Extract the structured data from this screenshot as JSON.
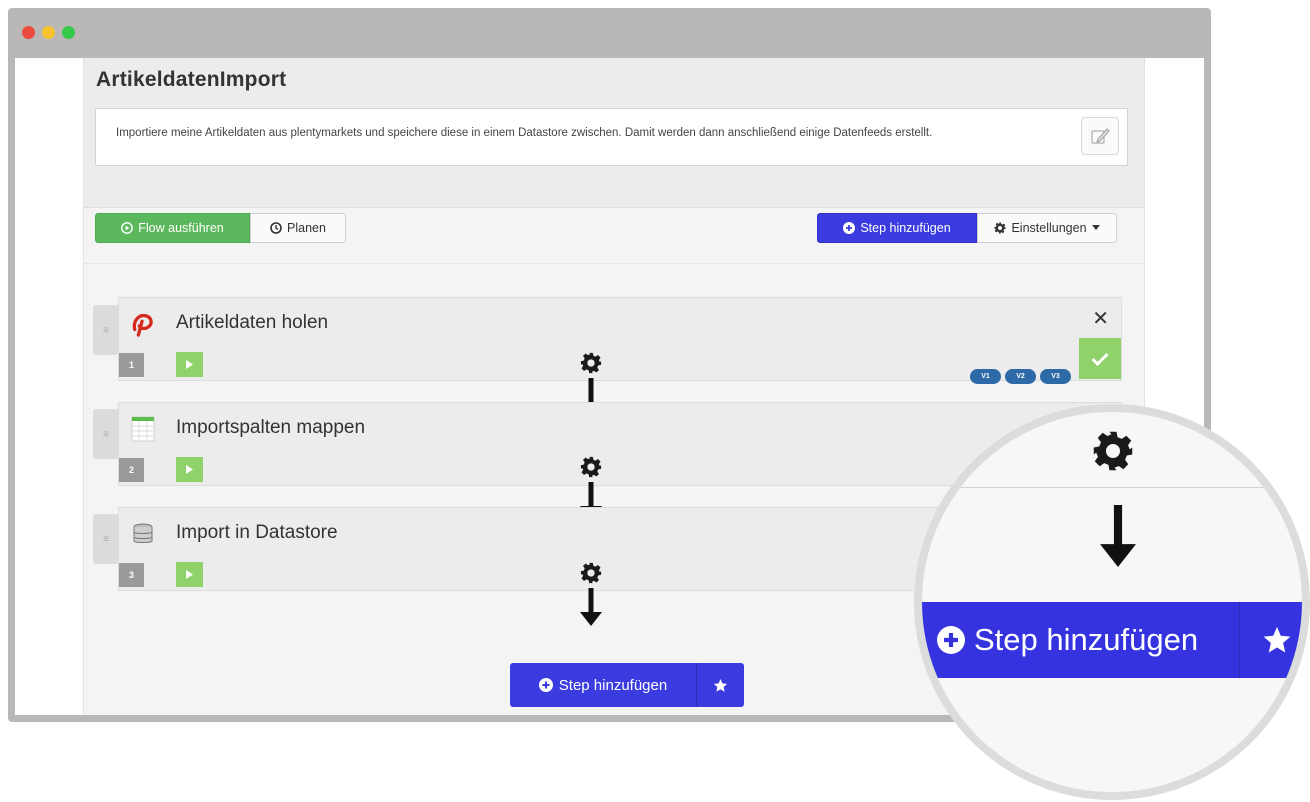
{
  "window": {
    "controls": [
      "close",
      "minimize",
      "maximize"
    ]
  },
  "flow": {
    "title": "ArtikeldatenImport",
    "description": "Importiere meine Artikeldaten aus plentymarkets und speichere diese in einem Datastore zwischen. Damit werden dann anschließend einige Datenfeeds erstellt."
  },
  "toolbar": {
    "run_label": "Flow ausführen",
    "plan_label": "Planen",
    "add_step_label": "Step hinzufügen",
    "settings_label": "Einstellungen"
  },
  "steps": [
    {
      "number": "1",
      "title": "Artikeldaten holen",
      "icon": "plentymarkets-logo-icon",
      "versions": [
        "V1",
        "V2",
        "V3"
      ]
    },
    {
      "number": "2",
      "title": "Importspalten mappen",
      "icon": "table-icon"
    },
    {
      "number": "3",
      "title": "Import in Datastore",
      "icon": "database-icon"
    }
  ],
  "bottom": {
    "add_step_label": "Step hinzufügen"
  },
  "zoom": {
    "add_step_label": "Step hinzufügen"
  },
  "colors": {
    "primary_blue": "#3a3ce0",
    "success_green": "#5cb85c",
    "play_green": "#8fd26a",
    "version_blue": "#2f6aa8"
  }
}
